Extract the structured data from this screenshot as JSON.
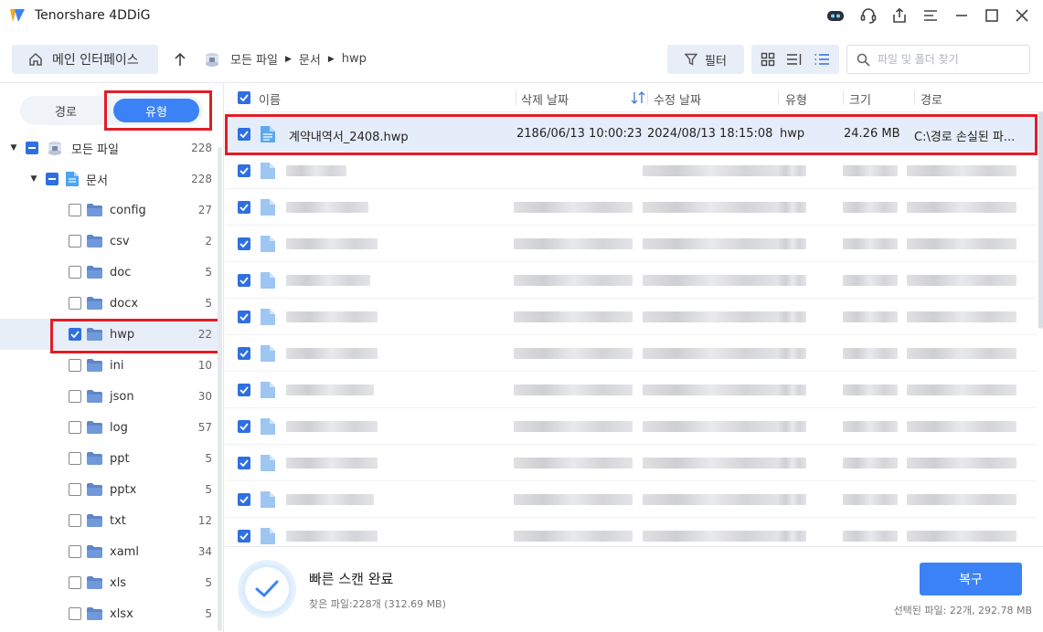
{
  "app": {
    "title": "Tenorshare 4DDiG"
  },
  "toolbar": {
    "home_label": "메인 인터페이스",
    "breadcrumb": [
      "모든 파일",
      "문서",
      "hwp"
    ],
    "filter_label": "필터",
    "search_placeholder": "파일 및 폴더 찾기"
  },
  "left_panel": {
    "tab_path": "경로",
    "tab_type": "유형",
    "tree": [
      {
        "label": "모든 파일",
        "count": "228"
      },
      {
        "label": "문서",
        "count": "228"
      },
      {
        "label": "config",
        "count": "27"
      },
      {
        "label": "csv",
        "count": "2"
      },
      {
        "label": "doc",
        "count": "5"
      },
      {
        "label": "docx",
        "count": "5"
      },
      {
        "label": "hwp",
        "count": "22"
      },
      {
        "label": "ini",
        "count": "10"
      },
      {
        "label": "json",
        "count": "30"
      },
      {
        "label": "log",
        "count": "57"
      },
      {
        "label": "ppt",
        "count": "5"
      },
      {
        "label": "pptx",
        "count": "5"
      },
      {
        "label": "txt",
        "count": "12"
      },
      {
        "label": "xaml",
        "count": "34"
      },
      {
        "label": "xls",
        "count": "5"
      },
      {
        "label": "xlsx",
        "count": "5"
      }
    ]
  },
  "table": {
    "headers": {
      "name": "이름",
      "deleted": "삭제 날짜",
      "modified": "수정 날짜",
      "type": "유형",
      "size": "크기",
      "path": "경로"
    },
    "first_row": {
      "name": "계약내역서_2408.hwp",
      "deleted": "2186/06/13 10:00:23",
      "modified": "2024/08/13 18:15:08",
      "type": "hwp",
      "size": "24.26 MB",
      "path": "C:\\경로 손실된 파..."
    }
  },
  "bottom": {
    "title": "빠른 스캔 완료",
    "found": "찾은 파일:228개 (312.69 MB)",
    "recover_label": "복구",
    "selected": "선택된 파일: 22개, 292.78 MB"
  },
  "colors": {
    "accent": "#3b82f6",
    "highlight": "#e11d26",
    "selection": "#e6edfa"
  }
}
